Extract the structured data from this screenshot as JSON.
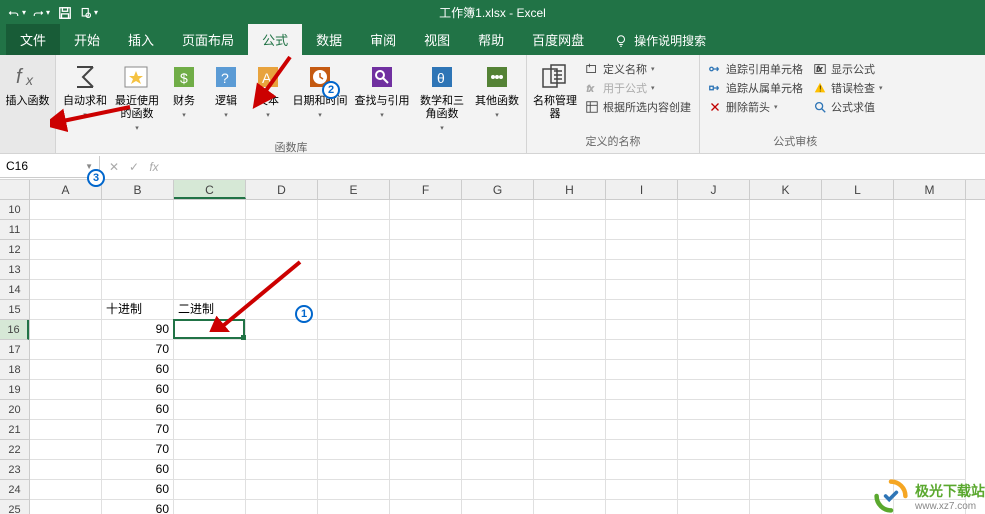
{
  "title": "工作簿1.xlsx - Excel",
  "tabs": [
    "文件",
    "开始",
    "插入",
    "页面布局",
    "公式",
    "数据",
    "审阅",
    "视图",
    "帮助",
    "百度网盘"
  ],
  "active_tab_index": 4,
  "tellme": "操作说明搜索",
  "ribbon": {
    "insert_fn": "插入函数",
    "autosum": "自动求和",
    "recent": "最近使用的函数",
    "financial": "财务",
    "logical": "逻辑",
    "text": "文本",
    "datetime": "日期和时间",
    "lookup": "查找与引用",
    "math": "数学和三角函数",
    "morefn": "其他函数",
    "fnlib_label": "函数库",
    "name_mgr": "名称管理器",
    "define_name": "定义名称",
    "use_in_formula": "用于公式",
    "create_from_sel": "根据所选内容创建",
    "names_label": "定义的名称",
    "trace_prec": "追踪引用单元格",
    "trace_dep": "追踪从属单元格",
    "remove_arrows": "删除箭头",
    "show_formulas": "显示公式",
    "error_check": "错误检查",
    "eval_formula": "公式求值",
    "audit_label": "公式审核"
  },
  "namebox": "C16",
  "fx_label": "fx",
  "columns": [
    "A",
    "B",
    "C",
    "D",
    "E",
    "F",
    "G",
    "H",
    "I",
    "J",
    "K",
    "L",
    "M"
  ],
  "row_start": 10,
  "row_end": 25,
  "cells": {
    "B15": "十进制",
    "C15": "二进制",
    "B16": "90",
    "B17": "70",
    "B18": "60",
    "B19": "60",
    "B20": "60",
    "B21": "70",
    "B22": "70",
    "B23": "60",
    "B24": "60",
    "B25": "60"
  },
  "active_cell": "C16",
  "watermark": {
    "name": "极光下载站",
    "url": "www.xz7.com"
  }
}
